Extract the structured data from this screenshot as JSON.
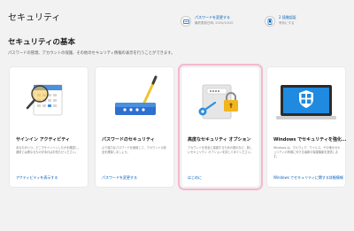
{
  "page": {
    "title": "セキュリティ"
  },
  "header_actions": [
    {
      "title": "パスワードを変更する",
      "subtitle": "最終更新日時: 2020/10/20"
    },
    {
      "title": "2 段階認証",
      "subtitle": "有効にする"
    }
  ],
  "section": {
    "title": "セキュリティの基本",
    "description": "パスワードの管理、アカウントの保護、その他のセキュリティ情報の表示を行うことができます。"
  },
  "cards": [
    {
      "title": "サインイン アクティビティ",
      "description": "あなたがいつ、どこでサインインしたかを確認し、通常とは異なるものがあればお知らせください。",
      "link": "アクティビティを表示する"
    },
    {
      "title": "パスワードのセキュリティ",
      "description": "より強力なパスワードを使用して、アカウントの安全を確保しましょう。",
      "link": "パスワードを変更する"
    },
    {
      "title": "高度なセキュリティ オプション",
      "description": "アカウントを安全に保護するための提示など、新しいセキュリティ オプションを試してみてください。",
      "link": "はじめに"
    },
    {
      "title": "Windows でセキュリティを強化...",
      "description": "Windows は、マルウェア、ウイルス、その他のセキュリティの脅威に対する最新の保護機能を提供します。",
      "link": "Windows でセキュリティに関する詳細情報"
    }
  ],
  "colors": {
    "accent": "#005fb8",
    "highlight": "#f5b7cf",
    "background": "#f2f2f2"
  },
  "icons": [
    "password-icon",
    "two-step-icon",
    "magnifier-calendar-icon",
    "password-device-icon",
    "key-lock-icon",
    "shield-laptop-icon"
  ]
}
